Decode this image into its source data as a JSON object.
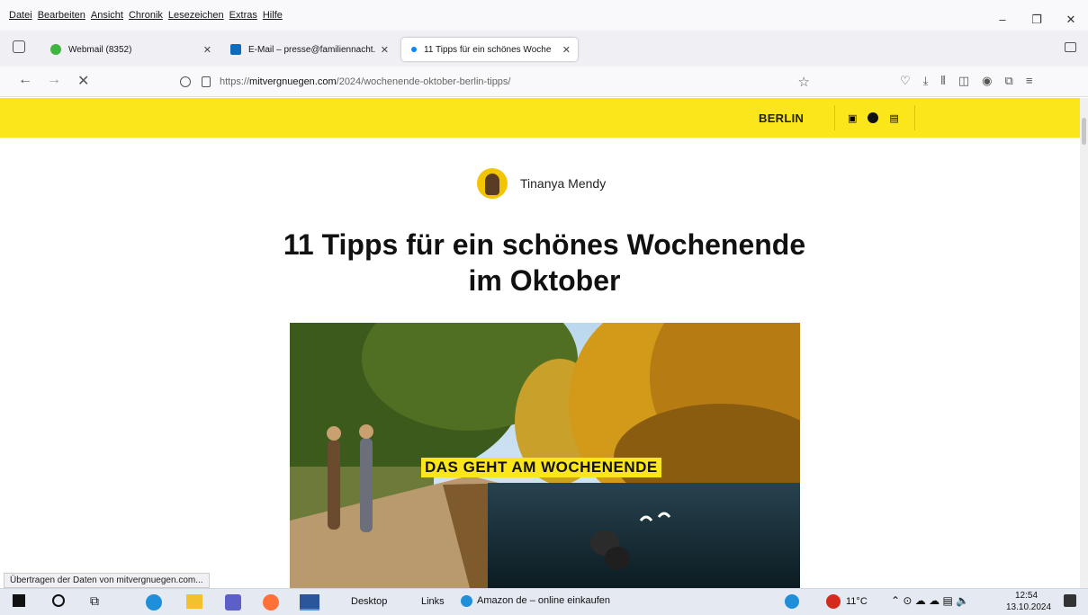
{
  "menubar": {
    "items": [
      "Datei",
      "Bearbeiten",
      "Ansicht",
      "Chronik",
      "Lesezeichen",
      "Extras",
      "Hilfe"
    ]
  },
  "window_controls": {
    "minimize": "–",
    "restore": "❐",
    "close": "✕"
  },
  "tabs": [
    {
      "label": "Webmail (8352)",
      "icon": "green-dot-icon",
      "close": "✕"
    },
    {
      "label": "E-Mail – presse@familiennacht.",
      "icon": "outlook-icon",
      "close": "✕"
    },
    {
      "label": "11 Tipps für ein schönes Woche",
      "icon": "loading-dot-icon",
      "close": "✕"
    }
  ],
  "navbar": {
    "url_prefix": "https://",
    "url_host": "mitvergnuegen.com",
    "url_path": "/2024/wochenende-oktober-berlin-tipps/"
  },
  "site": {
    "city": "BERLIN",
    "author": "Tinanya Mendy",
    "title": "11 Tipps für ein schönes Wochenende im Oktober",
    "hero_label": "DAS GEHT AM WOCHENENDE",
    "accent_color": "#fbe51b"
  },
  "status_text": "Übertragen der Daten von mitvergnuegen.com...",
  "taskbar": {
    "desktop_label": "Desktop",
    "links_label": "Links",
    "edge_item": "Amazon de – online einkaufen",
    "temperature": "11°C",
    "time": "12:54",
    "date": "13.10.2024"
  }
}
